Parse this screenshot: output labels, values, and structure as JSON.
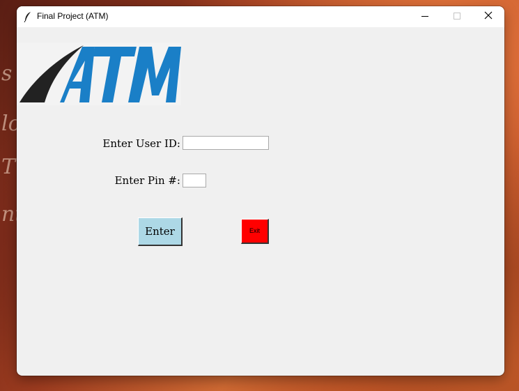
{
  "window": {
    "title": "Final Project (ATM)",
    "controls": [
      "minimize",
      "maximize",
      "close"
    ]
  },
  "logo": {
    "text": "ATM",
    "colors": {
      "swoosh": "#222222",
      "letters": "#1a7fc7"
    }
  },
  "form": {
    "user_id_label": "Enter User ID:",
    "user_id_value": "",
    "pin_label": "Enter Pin #:",
    "pin_value": ""
  },
  "buttons": {
    "enter_label": "Enter",
    "exit_label": "Exit"
  },
  "colors": {
    "enter_bg": "#add8e6",
    "exit_bg": "#ff0000",
    "window_bg": "#f0f0f0"
  }
}
